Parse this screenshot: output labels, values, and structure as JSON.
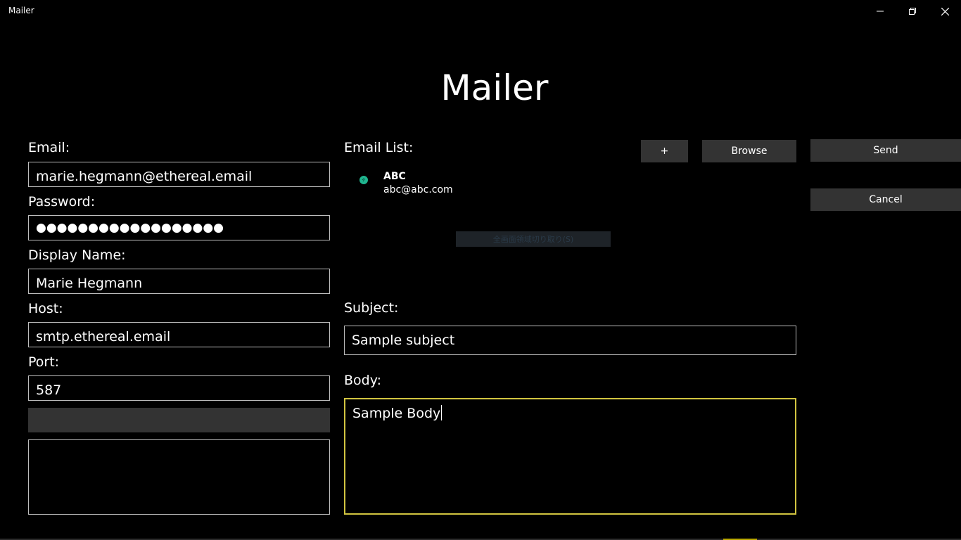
{
  "window": {
    "title": "Mailer"
  },
  "heading": "Mailer",
  "form": {
    "email_label": "Email:",
    "email_value": "marie.hegmann@ethereal.email",
    "password_label": "Password:",
    "password_value": "●●●●●●●●●●●●●●●●●●",
    "display_name_label": "Display Name:",
    "display_name_value": "Marie Hegmann",
    "host_label": "Host:",
    "host_value": "smtp.ethereal.email",
    "port_label": "Port:",
    "port_value": "587"
  },
  "email_list": {
    "label": "Email List:",
    "add_label": "+",
    "browse_label": "Browse",
    "items": [
      {
        "name": "ABC",
        "email": "abc@abc.com"
      }
    ]
  },
  "actions": {
    "send_label": "Send",
    "cancel_label": "Cancel"
  },
  "compose": {
    "subject_label": "Subject:",
    "subject_value": "Sample subject",
    "body_label": "Body:",
    "body_value": "Sample Body"
  },
  "tooltip": {
    "text": "全画面領域切り取り(S)"
  },
  "colors": {
    "accent_focus": "#d1c440",
    "contact_dot": "#1fb58f",
    "button_bg": "#333333"
  }
}
